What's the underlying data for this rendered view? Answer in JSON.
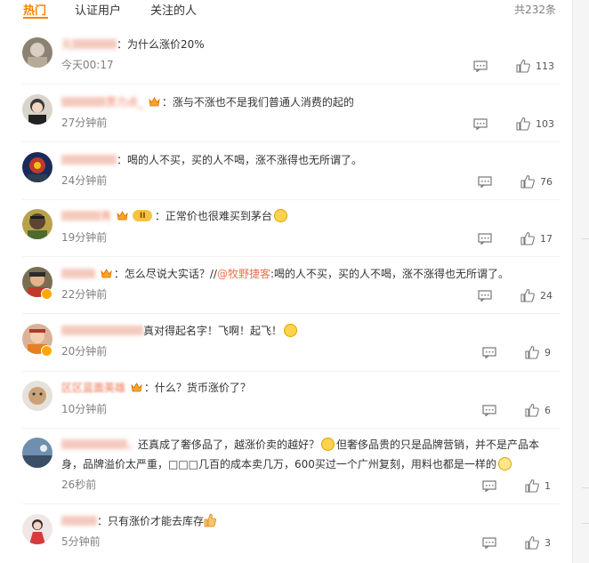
{
  "tabs": [
    {
      "label": "热门",
      "active": true
    },
    {
      "label": "认证用户",
      "active": false
    },
    {
      "label": "关注的人",
      "active": false
    }
  ],
  "total": "共232条",
  "comments": [
    {
      "user": "元",
      "text": "为什么涨价20%",
      "time": "今天00:17",
      "likes": "113"
    },
    {
      "user": "贾力点_",
      "text": "涨与不涨也不是我们普通人消费的起的",
      "time": "27分钟前",
      "likes": "103"
    },
    {
      "user": "",
      "text": "喝的人不买，买的人不喝，涨不涨得也无所谓了。",
      "time": "24分钟前",
      "likes": "76"
    },
    {
      "user": "亮",
      "text": "正常价也很难买到茅台",
      "time": "19分钟前",
      "likes": "17"
    },
    {
      "user": "",
      "text_a": "怎么尽说大实话？//",
      "mention": "@牧野捷客",
      "text_b": ":喝的人不买，买的人不喝，涨不涨得也无所谓了。",
      "time": "22分钟前",
      "likes": "24"
    },
    {
      "user": "",
      "text": "真对得起名字！飞啊！起飞！",
      "time": "20分钟前",
      "likes": "9"
    },
    {
      "user": "区区蓝面英雄",
      "text": "什么？货币涨价了？",
      "time": "10分钟前",
      "likes": "6"
    },
    {
      "user": "，",
      "text_a": "还真成了奢侈品了，越涨价卖的越好？",
      "text_b": "但奢侈品贵的只是品牌营销，并不是产品本身，品牌溢价太严重，□□□几百的成本卖几万，600买过一个广州复刻，用料也都是一样的",
      "time": "26秒前",
      "likes": "1"
    },
    {
      "user": "",
      "text": "只有涨价才能去库存",
      "time": "5分钟前",
      "likes": "3"
    }
  ],
  "colors": {
    "accent": "#ff8200",
    "username": "#eb7350",
    "meta": "#808080"
  }
}
